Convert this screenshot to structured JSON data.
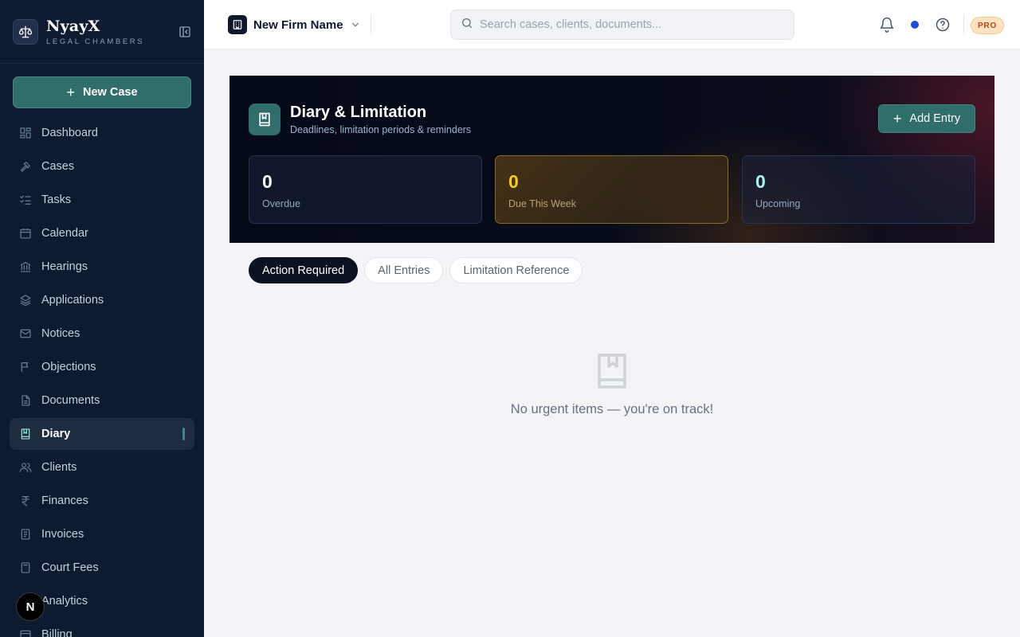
{
  "brand": {
    "name": "NyayX",
    "subtitle": "LEGAL CHAMBERS"
  },
  "sidebar": {
    "new_case_label": "New Case",
    "items": [
      {
        "label": "Dashboard",
        "icon": "dashboard-icon"
      },
      {
        "label": "Cases",
        "icon": "gavel-icon"
      },
      {
        "label": "Tasks",
        "icon": "checklist-icon"
      },
      {
        "label": "Calendar",
        "icon": "calendar-icon"
      },
      {
        "label": "Hearings",
        "icon": "courthouse-icon"
      },
      {
        "label": "Applications",
        "icon": "layers-icon"
      },
      {
        "label": "Notices",
        "icon": "mail-icon"
      },
      {
        "label": "Objections",
        "icon": "flag-icon"
      },
      {
        "label": "Documents",
        "icon": "document-icon"
      },
      {
        "label": "Diary",
        "icon": "diary-icon",
        "active": true
      },
      {
        "label": "Clients",
        "icon": "users-icon"
      },
      {
        "label": "Finances",
        "icon": "rupee-icon"
      },
      {
        "label": "Invoices",
        "icon": "invoice-icon"
      },
      {
        "label": "Court Fees",
        "icon": "calculator-icon"
      },
      {
        "label": "Analytics",
        "icon": "analytics-icon"
      },
      {
        "label": "Billing",
        "icon": "card-icon"
      }
    ],
    "floating_badge": "N"
  },
  "topbar": {
    "firm_name": "New Firm Name",
    "search_placeholder": "Search cases, clients, documents...",
    "plan_badge": "PRO"
  },
  "hero": {
    "title": "Diary & Limitation",
    "subtitle": "Deadlines, limitation periods & reminders",
    "add_entry_label": "Add Entry",
    "stats": {
      "overdue": {
        "value": "0",
        "label": "Overdue"
      },
      "due_this_week": {
        "value": "0",
        "label": "Due This Week"
      },
      "upcoming": {
        "value": "0",
        "label": "Upcoming"
      }
    }
  },
  "tabs": [
    {
      "label": "Action Required",
      "active": true
    },
    {
      "label": "All Entries",
      "active": false
    },
    {
      "label": "Limitation Reference",
      "active": false
    }
  ],
  "empty_state": {
    "message": "No urgent items — you're on track!"
  },
  "colors": {
    "sidebar_bg": "#0d1a2f",
    "accent_teal": "#2f6e6a",
    "warning_yellow": "#facc15",
    "status_dot_blue": "#1d4ed8",
    "pro_badge_text": "#c2410c"
  }
}
